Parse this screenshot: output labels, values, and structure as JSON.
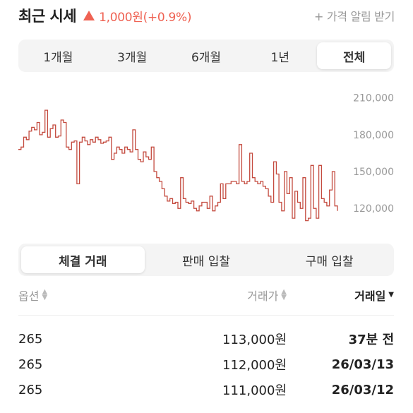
{
  "header": {
    "title": "최근 시세",
    "change": "1,000원(+0.9%)",
    "alarm_label": "+ 가격 알림 받기",
    "accent_color": "#ef6253"
  },
  "period_tabs": [
    {
      "label": "1개월",
      "active": false
    },
    {
      "label": "3개월",
      "active": false
    },
    {
      "label": "6개월",
      "active": false
    },
    {
      "label": "1년",
      "active": false
    },
    {
      "label": "전체",
      "active": true
    }
  ],
  "chart_data": {
    "type": "line",
    "title": "",
    "xlabel": "",
    "ylabel": "",
    "ylim": [
      100000,
      215000
    ],
    "yticks": [
      210000,
      180000,
      150000,
      120000
    ],
    "ytick_labels": [
      "210,000",
      "180,000",
      "150,000",
      "120,000"
    ],
    "grid": false,
    "line_color": "#c44a3e",
    "series": [
      {
        "values": [
          168000,
          170000,
          178000,
          176000,
          183000,
          186000,
          184000,
          190000,
          180000,
          182000,
          200000,
          178000,
          185000,
          188000,
          178000,
          179000,
          192000,
          190000,
          170000,
          168000,
          174000,
          175000,
          140000,
          174000,
          178000,
          175000,
          172000,
          176000,
          174000,
          178000,
          176000,
          173000,
          174000,
          175000,
          178000,
          160000,
          165000,
          170000,
          168000,
          165000,
          170000,
          168000,
          166000,
          184000,
          168000,
          160000,
          158000,
          166000,
          162000,
          160000,
          170000,
          150000,
          145000,
          142000,
          136000,
          130000,
          126000,
          128000,
          124000,
          125000,
          120000,
          145000,
          128000,
          125000,
          124000,
          126000,
          120000,
          118000,
          122000,
          125000,
          125000,
          120000,
          130000,
          118000,
          122000,
          125000,
          140000,
          128000,
          140000,
          140000,
          142000,
          142000,
          140000,
          172000,
          142000,
          140000,
          142000,
          165000,
          145000,
          142000,
          140000,
          142000,
          138000,
          136000,
          130000,
          125000,
          158000,
          148000,
          125000,
          118000,
          150000,
          132000,
          145000,
          112000,
          134000,
          125000,
          120000,
          145000,
          110000,
          112000,
          155000,
          120000,
          112000,
          155000,
          128000,
          125000,
          122000,
          135000,
          150000,
          122000,
          118000
        ]
      }
    ]
  },
  "trade_tabs": [
    {
      "label": "체결 거래",
      "active": true
    },
    {
      "label": "판매 입찰",
      "active": false
    },
    {
      "label": "구매 입찰",
      "active": false
    }
  ],
  "table": {
    "columns": {
      "option": "옵션",
      "price": "거래가",
      "date": "거래일"
    },
    "rows": [
      {
        "option": "265",
        "price": "113,000원",
        "date": "37분 전"
      },
      {
        "option": "265",
        "price": "112,000원",
        "date": "26/03/13"
      },
      {
        "option": "265",
        "price": "111,000원",
        "date": "26/03/12"
      }
    ]
  }
}
